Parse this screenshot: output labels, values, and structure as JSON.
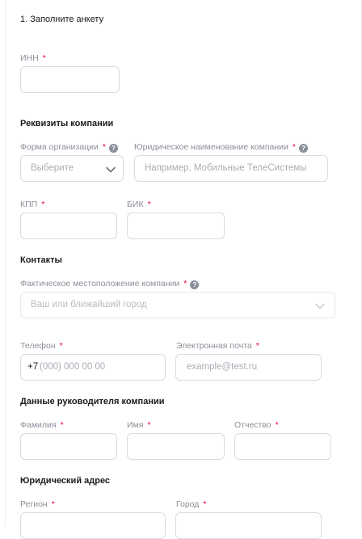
{
  "form": {
    "step_title": "1. Заполните анкету",
    "required_mark": "*",
    "help_glyph": "?",
    "inn": {
      "label": "ИНН"
    },
    "company_details": {
      "title": "Реквизиты компании",
      "org_form": {
        "label": "Форма организации",
        "placeholder": "Выберите"
      },
      "legal_name": {
        "label": "Юридическое наименование компании",
        "placeholder": "Например, Мобильные ТелеСистемы"
      },
      "kpp": {
        "label": "КПП"
      },
      "bik": {
        "label": "БИК"
      }
    },
    "contacts": {
      "title": "Контакты",
      "location": {
        "label": "Фактическое местоположение компании",
        "placeholder": "Ваш или ближайший город"
      },
      "phone": {
        "label": "Телефон",
        "prefix": "+7",
        "placeholder": "(000) 000 00 00"
      },
      "email": {
        "label": "Электронная почта",
        "placeholder": "example@test.ru"
      }
    },
    "director": {
      "title": "Данные руководителя компании",
      "last_name": {
        "label": "Фамилия"
      },
      "first_name": {
        "label": "Имя"
      },
      "patronymic": {
        "label": "Отчество"
      }
    },
    "legal_address": {
      "title": "Юридический адрес",
      "region": {
        "label": "Регион"
      },
      "city": {
        "label": "Город"
      }
    }
  },
  "colors": {
    "required": "#e4003a",
    "label": "#8a8f99",
    "border": "#d8dbe0",
    "placeholder": "#a8adb5"
  },
  "icons": {
    "help": "question-circle-icon",
    "dropdown": "chevron-down-icon"
  }
}
